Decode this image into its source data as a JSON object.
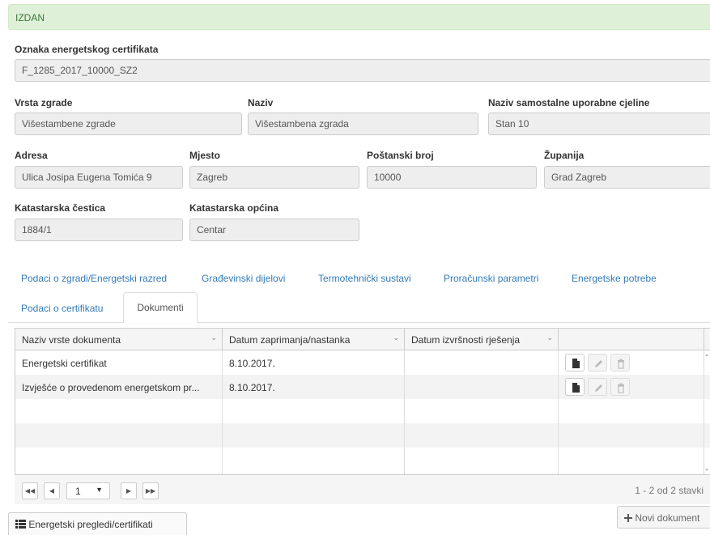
{
  "status": "IZDAN",
  "certificate": {
    "label": "Oznaka energetskog certifikata",
    "value": "F_1285_2017_10000_SZ2"
  },
  "building": {
    "type_label": "Vrsta zgrade",
    "type_value": "Višestambene zgrade",
    "name_label": "Naziv",
    "name_value": "Višestambena zgrada",
    "unit_label": "Naziv samostalne uporabne cjeline",
    "unit_value": "Stan 10"
  },
  "location": {
    "address_label": "Adresa",
    "address_value": "Ulica Josipa Eugena Tomića 9",
    "city_label": "Mjesto",
    "city_value": "Zagreb",
    "postal_label": "Poštanski broj",
    "postal_value": "10000",
    "county_label": "Županija",
    "county_value": "Grad Zagreb",
    "parcel_label": "Katastarska čestica",
    "parcel_value": "1884/1",
    "municipality_label": "Katastarska općina",
    "municipality_value": "Centar"
  },
  "tabs": [
    {
      "label": "Podaci o zgradi/Energetski razred"
    },
    {
      "label": "Građevinski dijelovi"
    },
    {
      "label": "Termotehnički sustavi"
    },
    {
      "label": "Proračunski parametri"
    },
    {
      "label": "Energetske potrebe"
    },
    {
      "label": "Podaci o certifikatu"
    },
    {
      "label": "Dokumenti",
      "active": true
    }
  ],
  "grid": {
    "columns": [
      "Naziv vrste dokumenta",
      "Datum zaprimanja/nastanka",
      "Datum izvršnosti rješenja",
      ""
    ],
    "rows": [
      {
        "name": "Energetski certifikat",
        "received": "8.10.2017.",
        "effective": ""
      },
      {
        "name": "Izvješće o provedenom energetskom pr...",
        "received": "8.10.2017.",
        "effective": ""
      }
    ],
    "row_actions": [
      "file-icon",
      "pencil-icon",
      "trash-icon"
    ]
  },
  "pager": {
    "page": "1",
    "info": "1 - 2 od 2 stavki"
  },
  "buttons": {
    "new_document": "Novi dokument",
    "list_certificates": "Energetski pregledi/certifikati"
  },
  "colors": {
    "status_bg": "#dff0d8",
    "status_text": "#3c763d",
    "link": "#337ab7",
    "field_bg": "#eeeeee"
  }
}
